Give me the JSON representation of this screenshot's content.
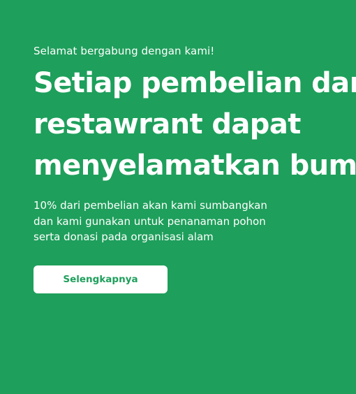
{
  "hero": {
    "eyebrow": "Selamat bergabung dengan kami!",
    "headline_lines": [
      "Setiap pembelian dari",
      "restawrant dapat",
      "menyelamatkan bumi"
    ],
    "description_lines": [
      "10% dari pembelian akan kami sumbangkan",
      "dan kami gunakan untuk penanaman pohon",
      "serta donasi pada organisasi alam"
    ],
    "cta_label": "Selengkapnya"
  },
  "colors": {
    "background": "#1e9f5b",
    "text": "#ffffff",
    "button_bg": "#ffffff",
    "button_text": "#1e9f5b"
  }
}
